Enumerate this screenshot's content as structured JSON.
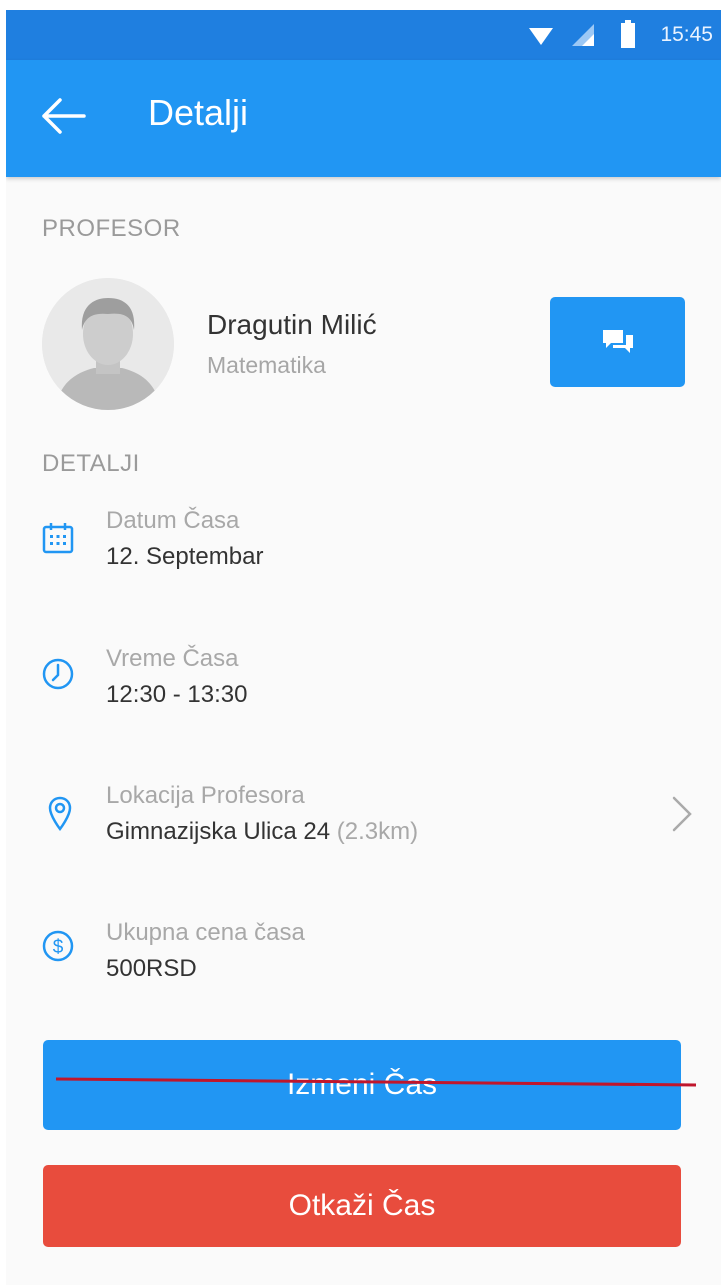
{
  "status_bar": {
    "time": "15:45",
    "icons": [
      "wifi-icon",
      "signal-icon",
      "battery-icon"
    ]
  },
  "app_bar": {
    "title": "Detalji",
    "back_icon": "arrow-left-icon"
  },
  "professor_section": {
    "label": "PROFESOR",
    "name": "Dragutin Milić",
    "subject": "Matematika",
    "message_icon": "chat-bubbles-icon"
  },
  "details_section": {
    "label": "DETALJI",
    "items": [
      {
        "icon": "calendar-icon",
        "label": "Datum Časa",
        "value": "12. Septembar"
      },
      {
        "icon": "clock-icon",
        "label": "Vreme Časa",
        "value": "12:30 - 13:30"
      },
      {
        "icon": "location-pin-icon",
        "label": "Lokacija Profesora",
        "value": "Gimnazijska Ulica 24",
        "extra": "(2.3km)"
      },
      {
        "icon": "dollar-coin-icon",
        "label": "Ukupna cena časa",
        "value": "500RSD"
      }
    ]
  },
  "buttons": {
    "edit": "Izmeni Čas",
    "cancel": "Otkaži Čas"
  },
  "colors": {
    "status_bar": "#1f7fe0",
    "primary": "#2196f3",
    "danger": "#e84c3d",
    "annotation_strike": "#c0162c"
  }
}
